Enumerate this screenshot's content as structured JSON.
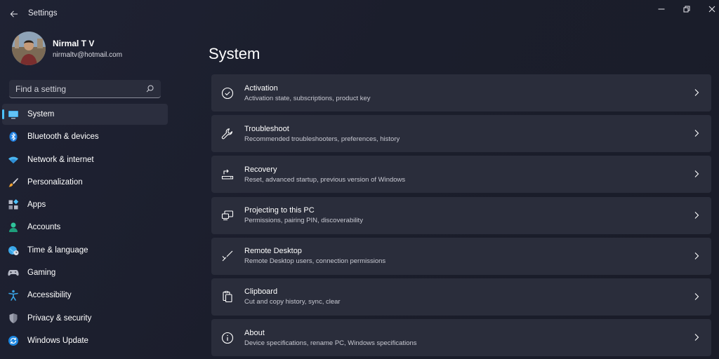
{
  "window": {
    "title": "Settings",
    "controls": [
      "minimize",
      "maximize",
      "close"
    ]
  },
  "profile": {
    "name": "Nirmal T V",
    "email": "nirmaltv@hotmail.com"
  },
  "search": {
    "placeholder": "Find a setting"
  },
  "sidebar": {
    "items": [
      {
        "label": "System",
        "icon": "display-icon",
        "selected": true
      },
      {
        "label": "Bluetooth & devices",
        "icon": "bluetooth-icon"
      },
      {
        "label": "Network & internet",
        "icon": "wifi-icon"
      },
      {
        "label": "Personalization",
        "icon": "brush-icon"
      },
      {
        "label": "Apps",
        "icon": "apps-icon"
      },
      {
        "label": "Accounts",
        "icon": "person-icon"
      },
      {
        "label": "Time & language",
        "icon": "globe-clock-icon"
      },
      {
        "label": "Gaming",
        "icon": "gamepad-icon"
      },
      {
        "label": "Accessibility",
        "icon": "accessibility-icon"
      },
      {
        "label": "Privacy & security",
        "icon": "shield-icon"
      },
      {
        "label": "Windows Update",
        "icon": "update-icon"
      }
    ]
  },
  "main": {
    "title": "System",
    "cards": [
      {
        "title": "Activation",
        "desc": "Activation state, subscriptions, product key",
        "icon": "check-circle-icon"
      },
      {
        "title": "Troubleshoot",
        "desc": "Recommended troubleshooters, preferences, history",
        "icon": "wrench-icon"
      },
      {
        "title": "Recovery",
        "desc": "Reset, advanced startup, previous version of Windows",
        "icon": "recovery-icon"
      },
      {
        "title": "Projecting to this PC",
        "desc": "Permissions, pairing PIN, discoverability",
        "icon": "projecting-icon"
      },
      {
        "title": "Remote Desktop",
        "desc": "Remote Desktop users, connection permissions",
        "icon": "remote-desktop-icon"
      },
      {
        "title": "Clipboard",
        "desc": "Cut and copy history, sync, clear",
        "icon": "clipboard-icon"
      },
      {
        "title": "About",
        "desc": "Device specifications, rename PC, Windows specifications",
        "icon": "info-icon"
      }
    ]
  },
  "colors": {
    "accent": "#4cc2ff",
    "background": "#1f2233",
    "card": "#2a2d3b"
  }
}
